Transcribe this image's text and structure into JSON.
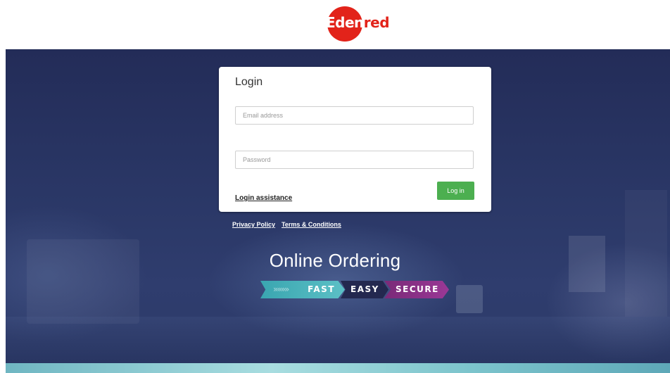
{
  "brand": {
    "logo_text_white": "Eden",
    "logo_text_red": "red",
    "brand_color": "#e2231a"
  },
  "login": {
    "title": "Login",
    "email_placeholder": "Email address",
    "email_value": "",
    "password_placeholder": "Password",
    "password_value": "",
    "assistance_link": "Login assistance",
    "submit_label": "Log in",
    "submit_color": "#4caf50"
  },
  "footer": {
    "privacy": "Privacy Policy",
    "terms": "Terms & Conditions"
  },
  "hero": {
    "headline": "Online Ordering",
    "taglines": [
      "FAST",
      "EASY",
      "SECURE"
    ],
    "chevrons": "»»»»",
    "colors": {
      "fast": "#3aa6b0",
      "easy": "#23284f",
      "secure": "#8a3188",
      "background": "#2a3766"
    }
  }
}
